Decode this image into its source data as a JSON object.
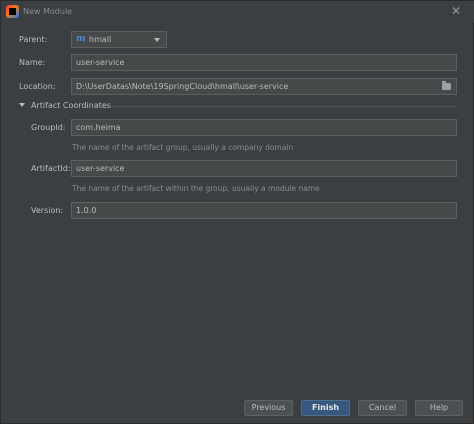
{
  "window": {
    "title": "New Module",
    "close_glyph": "✕"
  },
  "form": {
    "parent": {
      "label": "Parent:",
      "value": "hmall",
      "icon": "maven-icon"
    },
    "name": {
      "label": "Name:",
      "value": "user-service"
    },
    "location": {
      "label": "Location:",
      "value": "D:\\UserDatas\\Note\\19SpringCloud\\hmall\\user-service"
    },
    "artifact_section": {
      "title": "Artifact Coordinates"
    },
    "group_id": {
      "label": "GroupId:",
      "value": "com.heima",
      "hint": "The name of the artifact group, usually a company domain"
    },
    "artifact_id": {
      "label": "ArtifactId:",
      "value": "user-service",
      "hint": "The name of the artifact within the group, usually a module name"
    },
    "version": {
      "label": "Version:",
      "value": "1.0.0"
    }
  },
  "buttons": {
    "previous": "Previous",
    "finish": "Finish",
    "cancel": "Cancel",
    "help": "Help"
  },
  "colors": {
    "background": "#3c3f41",
    "field": "#45494a",
    "primary": "#365880"
  }
}
